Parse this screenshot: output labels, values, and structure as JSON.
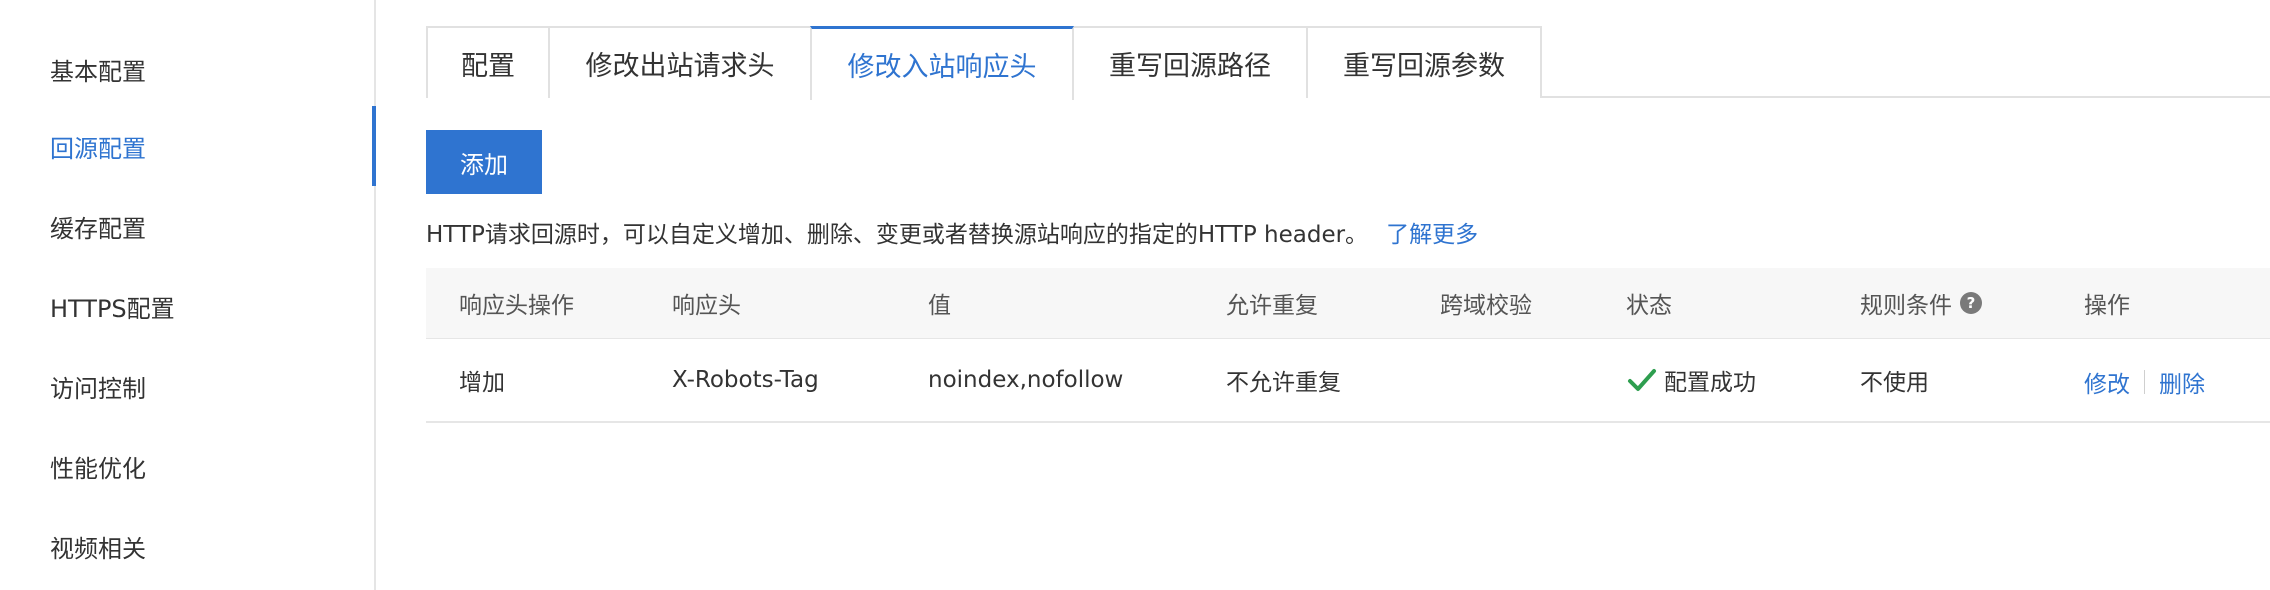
{
  "sidebar": {
    "items": [
      {
        "label": "基本配置",
        "active": false
      },
      {
        "label": "回源配置",
        "active": true
      },
      {
        "label": "缓存配置",
        "active": false
      },
      {
        "label": "HTTPS配置",
        "active": false
      },
      {
        "label": "访问控制",
        "active": false
      },
      {
        "label": "性能优化",
        "active": false
      },
      {
        "label": "视频相关",
        "active": false
      }
    ]
  },
  "tabs": [
    {
      "label": "配置",
      "active": false
    },
    {
      "label": "修改出站请求头",
      "active": false
    },
    {
      "label": "修改入站响应头",
      "active": true
    },
    {
      "label": "重写回源路径",
      "active": false
    },
    {
      "label": "重写回源参数",
      "active": false
    }
  ],
  "toolbar": {
    "add_label": "添加"
  },
  "description": {
    "text": "HTTP请求回源时，可以自定义增加、删除、变更或者替换源站响应的指定的HTTP header。",
    "learn_more": "了解更多"
  },
  "table": {
    "headers": [
      "响应头操作",
      "响应头",
      "值",
      "允许重复",
      "跨域校验",
      "状态",
      "规则条件",
      "操作"
    ],
    "help_glyph": "?",
    "rows": [
      {
        "operation": "增加",
        "header": "X-Robots-Tag",
        "value": "noindex,nofollow",
        "allow_duplicate": "不允许重复",
        "cors_check": "",
        "status": "配置成功",
        "condition": "不使用",
        "actions": {
          "edit": "修改",
          "delete": "删除"
        }
      }
    ]
  },
  "colors": {
    "accent": "#2f74d0",
    "success": "#2e9e4f",
    "text": "#333333"
  },
  "icons": {
    "status_success": "check-icon",
    "rule_condition_help": "question-circle-icon"
  }
}
